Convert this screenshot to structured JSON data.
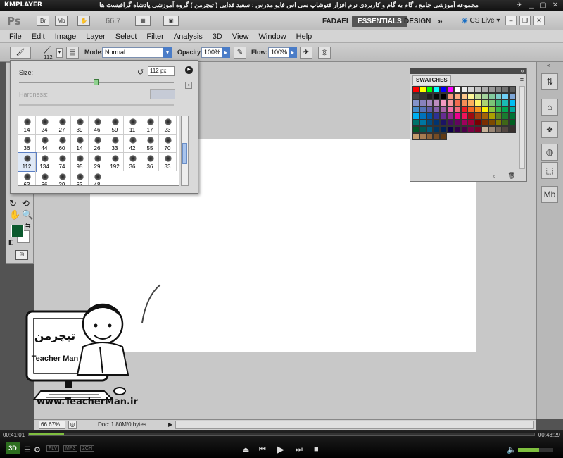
{
  "kmplayer": {
    "logo": "KMPLAYER",
    "title": "مجموعه آموزشی جامع ، گام به گام و کاربردی نرم افزار فتوشاپ سی اس فایو  مدرس : سعید فدایی ( تیچرمن ) گروه آموزشی پادشاه گرافیست ها",
    "time_elapsed": "00:41:01",
    "time_total": "00:43:29",
    "progress": 0.07,
    "badge_3d": "3D",
    "badges": [
      "FLV",
      "MP3",
      "2CH"
    ],
    "volume": 0.6
  },
  "appbar": {
    "ps_logo": "Ps",
    "br": "Br",
    "mb": "Mb",
    "zoom": "66.7",
    "workspaces": [
      "FADAEI",
      "ESSENTIALS",
      "DESIGN"
    ],
    "active_workspace": "ESSENTIALS",
    "more": "»",
    "cs_live": "CS Live"
  },
  "menu": [
    "File",
    "Edit",
    "Image",
    "Layer",
    "Select",
    "Filter",
    "Analysis",
    "3D",
    "View",
    "Window",
    "Help"
  ],
  "options": {
    "brush_size": "112",
    "mode_label": "Mode:",
    "mode_value": "Normal",
    "opacity_label": "Opacity:",
    "opacity_value": "100%",
    "flow_label": "Flow:",
    "flow_value": "100%"
  },
  "brush_panel": {
    "size_label": "Size:",
    "size_value": "112 px",
    "size_fraction": 0.5,
    "hardness_label": "Hardness:",
    "brushes": [
      "14",
      "24",
      "27",
      "39",
      "46",
      "59",
      "11",
      "17",
      "23",
      "36",
      "44",
      "60",
      "14",
      "26",
      "33",
      "42",
      "55",
      "70",
      "112",
      "134",
      "74",
      "95",
      "29",
      "192",
      "36",
      "36",
      "33",
      "63",
      "66",
      "39",
      "63",
      "48"
    ],
    "selected": "112"
  },
  "swatches": {
    "tab": "SWATCHES",
    "colors": [
      "#ff0000",
      "#ffff00",
      "#00ff00",
      "#00ffff",
      "#0000ff",
      "#ff00ff",
      "#ffffff",
      "#ebebeb",
      "#d6d6d6",
      "#c2c2c2",
      "#adadad",
      "#999999",
      "#858585",
      "#707070",
      "#5c5c5c",
      "#474747",
      "#333333",
      "#1f1f1f",
      "#0a0a0a",
      "#000000",
      "#f7977a",
      "#f9ad81",
      "#fdc68a",
      "#fff79a",
      "#c4df9b",
      "#a2d39c",
      "#82ca9d",
      "#7bcdc8",
      "#6ecff6",
      "#7ea7d8",
      "#8493ca",
      "#8882be",
      "#a187be",
      "#bc8dbf",
      "#f49ac2",
      "#f6989d",
      "#f26c4f",
      "#f68e55",
      "#fbaf5c",
      "#fff467",
      "#acd372",
      "#7cc576",
      "#3bb878",
      "#1abbb4",
      "#00bff3",
      "#438cca",
      "#5574b9",
      "#605ca8",
      "#855fa8",
      "#a763a8",
      "#f06ea9",
      "#f26d7d",
      "#ed1c24",
      "#f26522",
      "#f7941d",
      "#fff200",
      "#8dc73f",
      "#39b54a",
      "#00a651",
      "#00a99d",
      "#00aeef",
      "#0072bc",
      "#0054a6",
      "#2e3192",
      "#662d91",
      "#92278f",
      "#ec008c",
      "#ed145b",
      "#9e0b0f",
      "#a0410d",
      "#a36209",
      "#aba000",
      "#598527",
      "#1a7b30",
      "#007236",
      "#00746b",
      "#0076a3",
      "#004b80",
      "#003471",
      "#1b1464",
      "#440e62",
      "#630460",
      "#9e005d",
      "#9e0039",
      "#790000",
      "#7b2e00",
      "#7d4900",
      "#827b00",
      "#406618",
      "#005e20",
      "#005826",
      "#005952",
      "#005b7f",
      "#003663",
      "#002157",
      "#0d004c",
      "#32004b",
      "#4b0049",
      "#7b0046",
      "#7a0026",
      "#c7b299",
      "#998675",
      "#736357",
      "#534741",
      "#37302d",
      "#c69c6d",
      "#a67c52",
      "#8c6239",
      "#754c24",
      "#603913"
    ]
  },
  "status": {
    "zoom": "66.67%",
    "doc": "Doc: 1.80M/0 bytes"
  },
  "watermark": {
    "brand_fa": "تیچرمن",
    "brand_en": "Teacher Man",
    "site": "www.TeacherMan.ir"
  }
}
